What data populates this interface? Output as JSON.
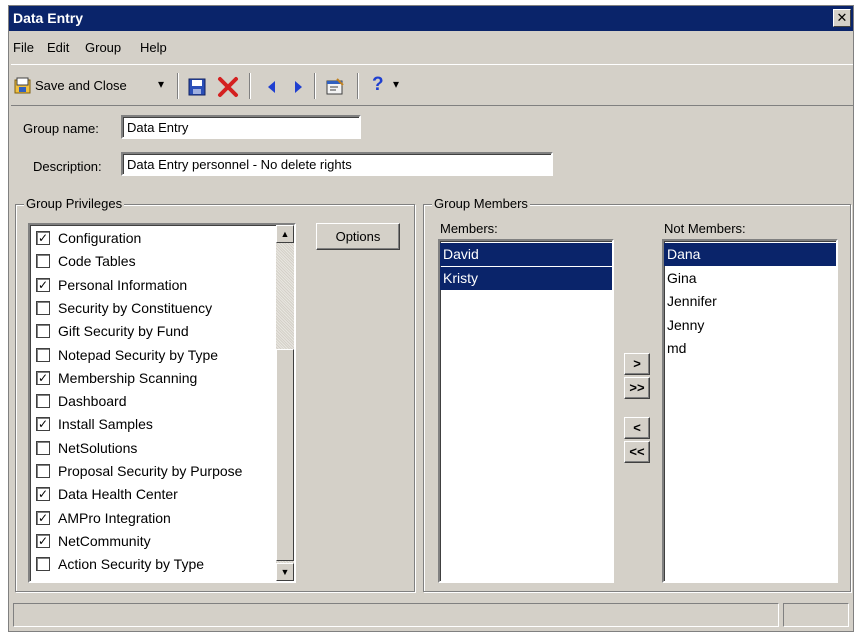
{
  "window": {
    "title": "Data Entry",
    "close_glyph": "✕"
  },
  "menu": [
    "File",
    "Edit",
    "Group",
    "Help"
  ],
  "toolbar": {
    "save_close_label": "Save and Close",
    "dropdown_glyph": "▾",
    "help_glyph": "?"
  },
  "form": {
    "group_name_label": "Group name:",
    "group_name_value": "Data Entry",
    "description_label": "Description:",
    "description_value": "Data Entry personnel - No delete rights"
  },
  "privileges": {
    "title": "Group Privileges",
    "options_label": "Options",
    "items": [
      {
        "label": "Configuration",
        "checked": true
      },
      {
        "label": "Code Tables",
        "checked": false
      },
      {
        "label": "Personal Information",
        "checked": true
      },
      {
        "label": "Security by Constituency",
        "checked": false
      },
      {
        "label": "Gift Security by Fund",
        "checked": false
      },
      {
        "label": "Notepad Security by Type",
        "checked": false
      },
      {
        "label": "Membership Scanning",
        "checked": true
      },
      {
        "label": "Dashboard",
        "checked": false
      },
      {
        "label": "Install Samples",
        "checked": true
      },
      {
        "label": "NetSolutions",
        "checked": false
      },
      {
        "label": "Proposal Security by Purpose",
        "checked": false
      },
      {
        "label": "Data Health Center",
        "checked": true
      },
      {
        "label": "AMPro Integration",
        "checked": true
      },
      {
        "label": "NetCommunity",
        "checked": true
      },
      {
        "label": "Action Security by Type",
        "checked": false
      }
    ]
  },
  "members": {
    "title": "Group Members",
    "members_label": "Members:",
    "not_members_label": "Not Members:",
    "members": [
      {
        "name": "David",
        "selected": true
      },
      {
        "name": "Kristy",
        "selected": true
      }
    ],
    "not_members": [
      {
        "name": "Dana",
        "selected": true
      },
      {
        "name": "Gina",
        "selected": false
      },
      {
        "name": "Jennifer",
        "selected": false
      },
      {
        "name": "Jenny",
        "selected": false
      },
      {
        "name": "md",
        "selected": false
      }
    ],
    "move_buttons": [
      ">",
      ">>",
      "<",
      "<<"
    ]
  },
  "colors": {
    "title_bar": "#0a246a",
    "selection": "#0a246a",
    "delete_red": "#d42020",
    "nav_blue": "#1f3fd0"
  }
}
